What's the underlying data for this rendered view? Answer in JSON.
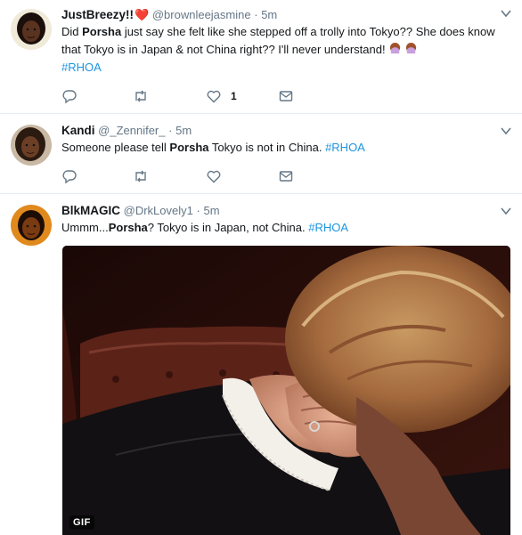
{
  "tweets": [
    {
      "name": "JustBreezy!!",
      "handle": "@brownleejasmine",
      "separator": "·",
      "time": "5m",
      "text_pre": "Did ",
      "text_bold": "Porsha",
      "text_post": " just say she felt like she stepped off a trolly into Tokyo?? She does know that Tokyo is in Japan & not China right?? I'll never understand!",
      "hashtag": "#RHOA",
      "like_count": "1"
    },
    {
      "name": "Kandi",
      "handle": "@_Zennifer_",
      "separator": "·",
      "time": "5m",
      "text_pre": "Someone please tell ",
      "text_bold": "Porsha",
      "text_post": " Tokyo is not in China. ",
      "hashtag": "#RHOA"
    },
    {
      "name": "BlkMAGIC",
      "handle": "@DrkLovely1",
      "separator": "·",
      "time": "5m",
      "text_pre": "Ummm...",
      "text_bold": "Porsha",
      "text_post": "? Tokyo is in Japan, not China.  ",
      "hashtag": "#RHOA",
      "media_badge": "GIF"
    }
  ],
  "colors": {
    "link": "#1b95e0",
    "secondary": "#657786",
    "heart": "#cc0b2b"
  },
  "icons": [
    "reply-icon",
    "retweet-icon",
    "like-icon",
    "direct-message-icon",
    "caret-down-icon"
  ]
}
